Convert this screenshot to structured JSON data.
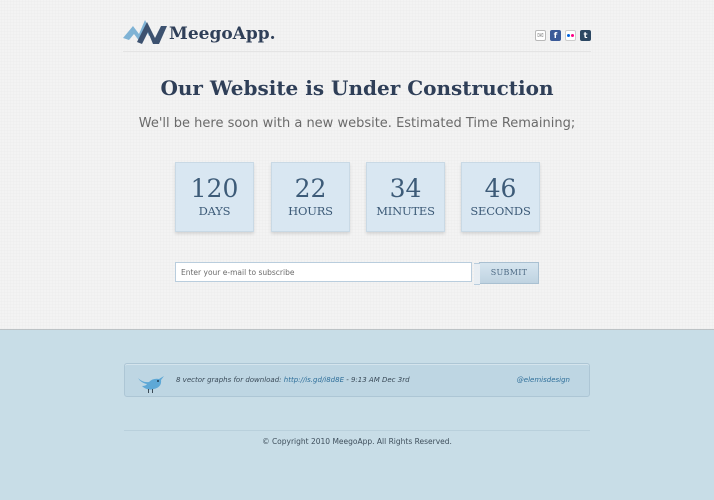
{
  "header": {
    "logo_text": "MeegoApp.",
    "social_icons": [
      "mail-icon",
      "facebook-icon",
      "flickr-icon",
      "tumblr-icon"
    ]
  },
  "main": {
    "title": "Our Website is Under Construction",
    "subtitle": "We'll be here soon with a new website. Estimated Time Remaining;"
  },
  "countdown": [
    {
      "value": "120",
      "label": "DAYS"
    },
    {
      "value": "22",
      "label": "HOURS"
    },
    {
      "value": "34",
      "label": "MINUTES"
    },
    {
      "value": "46",
      "label": "SECONDS"
    }
  ],
  "subscribe": {
    "placeholder": "Enter your e-mail to subscribe",
    "button_label": "SUBMIT"
  },
  "tweet": {
    "text": "8 vector graphs for download: ",
    "link": "http://is.gd/i8d8E",
    "time": " - 9:13 AM Dec 3rd",
    "handle": "@elemisdesign"
  },
  "footer": {
    "copyright": "© Copyright 2010 MeegoApp. All Rights Reserved."
  },
  "colors": {
    "brand_dark": "#2f3f58",
    "countdown_box": "#d9e7f2",
    "footer_bg": "#c8dde7",
    "link": "#2f6f9a"
  }
}
